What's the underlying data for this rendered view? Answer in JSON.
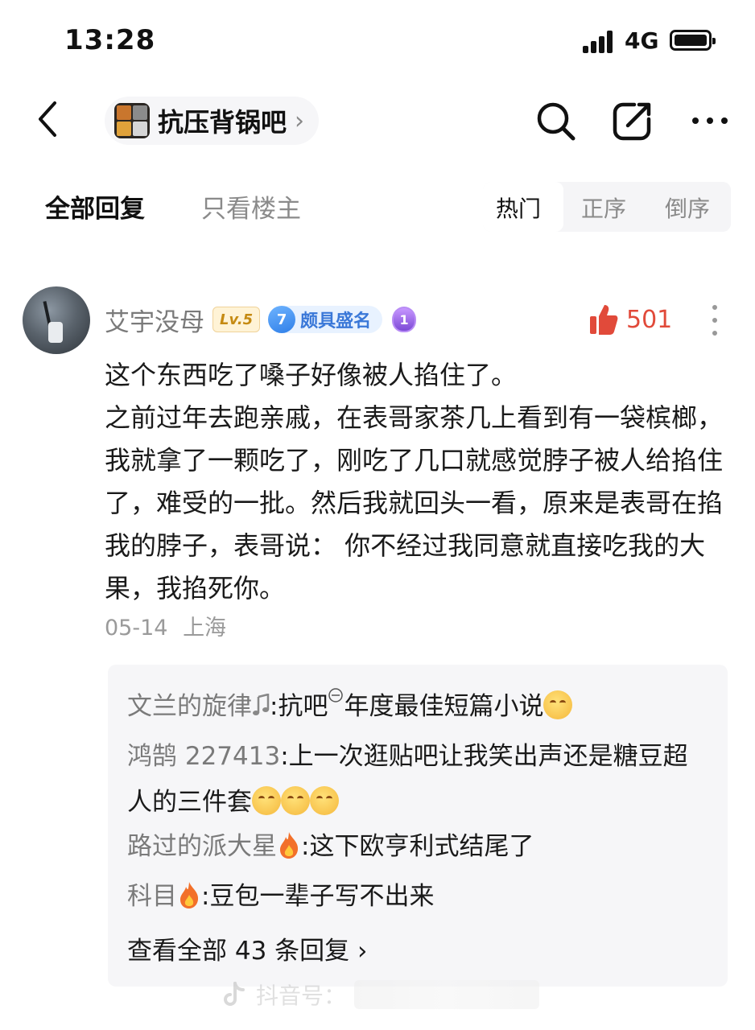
{
  "status_bar": {
    "time": "13:28",
    "network": "4G"
  },
  "nav": {
    "forum_name": "抗压背锅吧"
  },
  "tabs": {
    "all_replies": "全部回复",
    "op_only": "只看楼主",
    "sort": [
      "热门",
      "正序",
      "倒序"
    ]
  },
  "comment": {
    "username": "艾宇没母",
    "level": "Lv.5",
    "rank_number": "7",
    "rank_title": "颇具盛名",
    "medal_number": "1",
    "likes": "501",
    "paragraphs": [
      "这个东西吃了嗓子好像被人掐住了。",
      "之前过年去跑亲戚，在表哥家茶几上看到有一袋槟榔，我就拿了一颗吃了，刚吃了几口就感觉脖子被人给掐住了，难受的一批。然后我就回头一看，原来是表哥在掐我的脖子，表哥说： 你不经过我同意就直接吃我的大果，我掐死你。"
    ],
    "date": "05-14",
    "location": "上海"
  },
  "replies": [
    {
      "name": "文兰的旋律",
      "sep": ":",
      "text_a": "抗吧",
      "text_b": "年度最佳短篇小说"
    },
    {
      "name": "鸿鹄 227413",
      "sep": ":",
      "text": "上一次逛贴吧让我笑出声还是糖豆超人的三件套"
    },
    {
      "name": "路过的派大星",
      "sep": ":",
      "text": "这下欧亨利式结尾了"
    },
    {
      "name": "科目",
      "sep": ":",
      "text": "豆包一辈子写不出来"
    }
  ],
  "view_all": "查看全部 43 条回复 ›",
  "watermark": {
    "text": "抖音号："
  },
  "colors": {
    "like_red": "#e14a3a",
    "rank_blue": "#3a78d8",
    "level_gold": "#c58a12"
  }
}
